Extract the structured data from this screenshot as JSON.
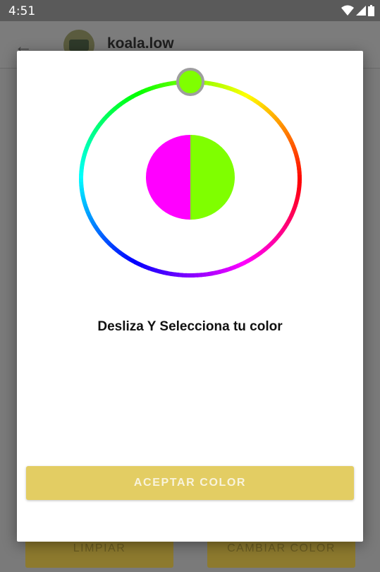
{
  "status_bar": {
    "time": "4:51"
  },
  "app_bar": {
    "username": "koala.low"
  },
  "background_buttons": {
    "left_label": "LIMPIAR",
    "right_label": "CAMBIAR COLOR"
  },
  "dialog": {
    "instruction": "Desliza Y Selecciona tu color",
    "accept_label": "ACEPTAR COLOR",
    "old_color": "#FF00FF",
    "new_color": "#7FFF00",
    "selector_color": "#7FFF00"
  },
  "colors": {
    "accent": "#E3CD63",
    "scrim": "#7A7A7A"
  }
}
